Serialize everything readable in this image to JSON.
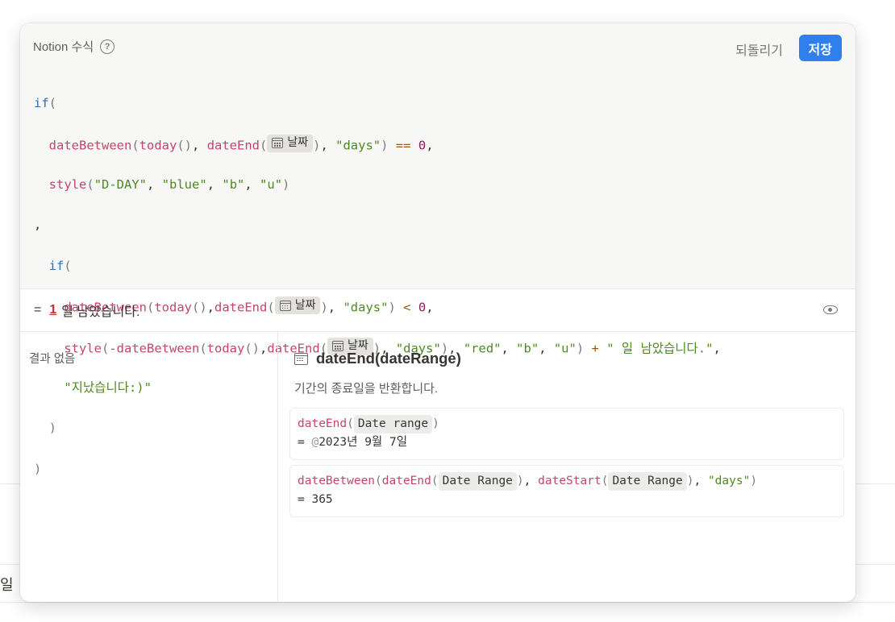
{
  "page": {
    "bg_fragment": "일"
  },
  "modal": {
    "title": "Notion 수식",
    "help_icon": "?",
    "undo_label": "되돌리기",
    "save_label": "저장"
  },
  "code": {
    "if1": "if",
    "dateBetween": "dateBetween",
    "today": "today",
    "dateEnd": "dateEnd",
    "style": "style",
    "chip_label": "날짜",
    "days": "\"days\"",
    "zero": "0",
    "dday": "\"D-DAY\"",
    "blue": "\"blue\"",
    "b": "\"b\"",
    "u": "\"u\"",
    "red": "\"red\"",
    "remain": "\" 일 남았습니다.\"",
    "passed": "\"지났습니다:)\"",
    "neg_dateBetween": "-dateBetween"
  },
  "result": {
    "eq": "=",
    "value": "1",
    "suffix": "일 남았습니다."
  },
  "left_panel": {
    "no_result": "결과 없음"
  },
  "docs": {
    "title": "dateEnd(dateRange)",
    "description": "기간의 종료일을 반환합니다.",
    "ex1": {
      "fn": "dateEnd",
      "arg": "Date range",
      "result_eq": "= ",
      "result_at": "@",
      "result": "2023년 9월 7일"
    },
    "ex2": {
      "fn_outer": "dateBetween",
      "fn_a": "dateEnd",
      "arg_a": "Date Range",
      "fn_b": "dateStart",
      "arg_b": "Date Range",
      "unit": "\"days\"",
      "result": "= 365"
    }
  }
}
